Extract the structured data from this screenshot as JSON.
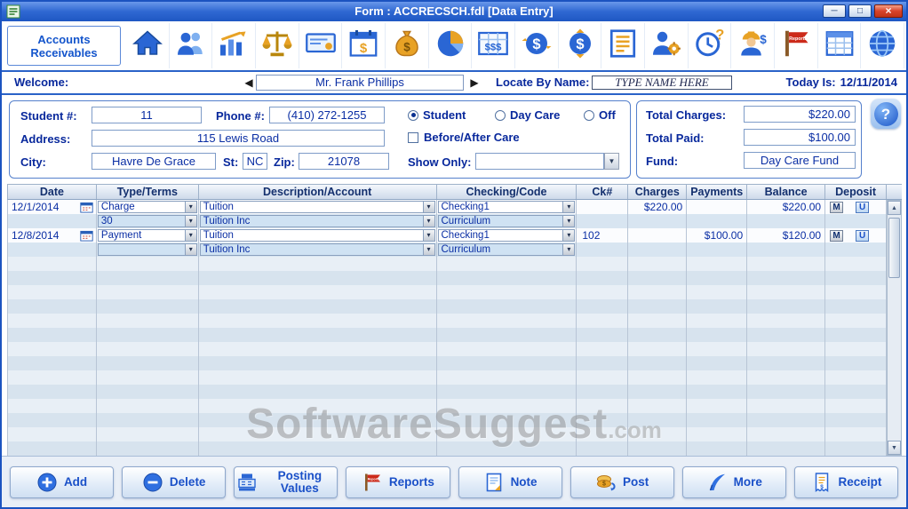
{
  "window": {
    "title": "Form : ACCRECSCH.fdl [Data Entry]",
    "controls": {
      "minimize": "─",
      "maximize": "□",
      "close": "×"
    }
  },
  "glyphs": {
    "dropdown": "▾",
    "combo": "▼",
    "nav_left": "◀",
    "nav_right": "▶",
    "scroll_up": "▲",
    "scroll_down": "▼",
    "help": "?"
  },
  "toolbar": {
    "module_label": "Accounts Receivables",
    "icons": [
      "home-icon",
      "users-icon",
      "chart-icon",
      "scales-icon",
      "checkbook-icon",
      "calendar-dollar-icon",
      "money-bag-icon",
      "pie-chart-icon",
      "ledger-icon",
      "dollar-transfer-icon",
      "dollar-exchange-icon",
      "form-list-icon",
      "user-settings-icon",
      "time-question-icon",
      "worker-dollar-icon",
      "reports-flag-icon",
      "spreadsheet-icon",
      "globe-icon"
    ]
  },
  "welcome": {
    "label": "Welcome:",
    "current_name": "Mr. Frank Phillips",
    "locate_label": "Locate By Name:",
    "locate_value": "TYPE NAME HERE",
    "today_label": "Today Is:",
    "today_value": "12/11/2014"
  },
  "form": {
    "student_label": "Student #:",
    "student_value": "11",
    "phone_label": "Phone #:",
    "phone_value": "(410) 272-1255",
    "radio_student": "Student",
    "radio_daycare": "Day Care",
    "radio_off": "Off",
    "radio_selected": "Student",
    "address_label": "Address:",
    "address_value": "115 Lewis Road",
    "before_after_label": "Before/After Care",
    "city_label": "City:",
    "city_value": "Havre De Grace",
    "st_label": "St:",
    "st_value": "NC",
    "zip_label": "Zip:",
    "zip_value": "21078",
    "show_only_label": "Show Only:",
    "show_only_value": "",
    "total_charges_label": "Total Charges:",
    "total_charges_value": "$220.00",
    "total_paid_label": "Total Paid:",
    "total_paid_value": "$100.00",
    "fund_label": "Fund:",
    "fund_value": "Day Care Fund"
  },
  "table": {
    "headers": [
      "Date",
      "Type/Terms",
      "Description/Account",
      "Checking/Code",
      "Ck#",
      "Charges",
      "Payments",
      "Balance",
      "Deposit"
    ],
    "rows": [
      {
        "date": "12/1/2014",
        "date_icon": true,
        "type": "Charge",
        "type_dd": true,
        "desc": "Tuition",
        "desc_dd": true,
        "check": "Checking1",
        "check_dd": true,
        "ck": "",
        "charges": "$220.00",
        "payments": "",
        "balance": "$220.00",
        "mu": true
      },
      {
        "date": "",
        "type": "30",
        "type_dd": true,
        "desc": "Tuition Inc",
        "desc_dd": true,
        "check": "Curriculum",
        "check_dd": true,
        "ck": "",
        "charges": "",
        "payments": "",
        "balance": "",
        "mu": false
      },
      {
        "date": "12/8/2014",
        "date_icon": true,
        "type": "Payment",
        "type_dd": true,
        "desc": "Tuition",
        "desc_dd": true,
        "check": "Checking1",
        "check_dd": true,
        "ck": "102",
        "charges": "",
        "payments": "$100.00",
        "balance": "$120.00",
        "mu": true
      },
      {
        "date": "",
        "type": "",
        "type_dd": true,
        "desc": "Tuition Inc",
        "desc_dd": true,
        "check": "Curriculum",
        "check_dd": true,
        "ck": "",
        "charges": "",
        "payments": "",
        "balance": "",
        "mu": false
      }
    ],
    "empty_rows": 14
  },
  "deposit_buttons": {
    "m": "M",
    "u": "U"
  },
  "footer": {
    "buttons": [
      {
        "label": "Add",
        "icon": "add-circle-icon"
      },
      {
        "label": "Delete",
        "icon": "delete-circle-icon"
      },
      {
        "label": "Posting Values",
        "icon": "posting-values-icon"
      },
      {
        "label": "Reports",
        "icon": "reports-flag-icon"
      },
      {
        "label": "Note",
        "icon": "note-icon"
      },
      {
        "label": "Post",
        "icon": "post-coins-icon"
      },
      {
        "label": "More",
        "icon": "more-quill-icon"
      },
      {
        "label": "Receipt",
        "icon": "receipt-icon"
      }
    ]
  },
  "watermark": {
    "main": "SoftwareSuggest",
    "suffix": ".com"
  }
}
